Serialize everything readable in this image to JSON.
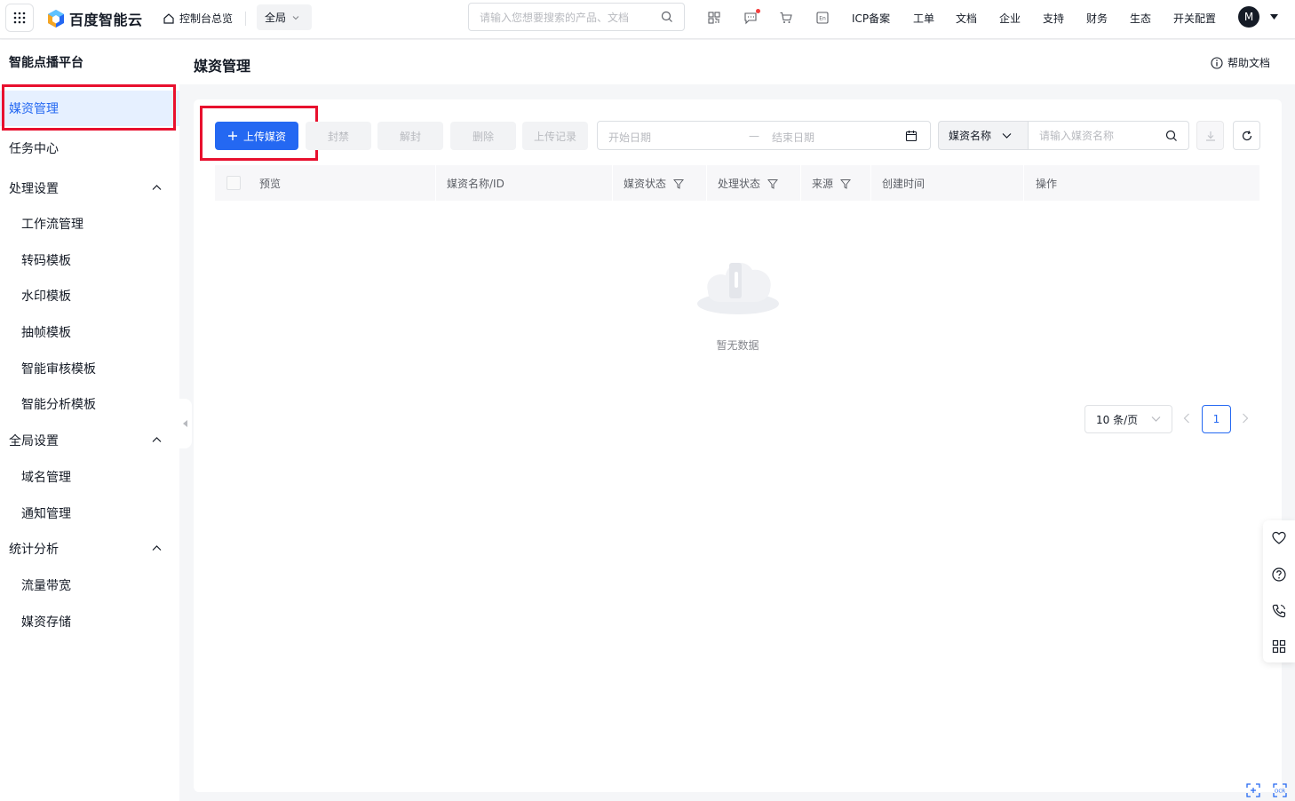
{
  "topbar": {
    "logo_text": "百度智能云",
    "console_label": "控制台总览",
    "region_label": "全局",
    "search_placeholder": "请输入您想要搜索的产品、文档",
    "nav": [
      "ICP备案",
      "工单",
      "文档",
      "企业",
      "支持",
      "财务",
      "生态",
      "开关配置"
    ],
    "avatar_letter": "M"
  },
  "sidebar": {
    "title": "智能点播平台",
    "items": [
      {
        "label": "媒资管理",
        "level": "top",
        "active": true
      },
      {
        "label": "任务中心",
        "level": "top"
      },
      {
        "label": "处理设置",
        "level": "group"
      },
      {
        "label": "工作流管理",
        "level": "sub"
      },
      {
        "label": "转码模板",
        "level": "sub"
      },
      {
        "label": "水印模板",
        "level": "sub"
      },
      {
        "label": "抽帧模板",
        "level": "sub"
      },
      {
        "label": "智能审核模板",
        "level": "sub"
      },
      {
        "label": "智能分析模板",
        "level": "sub"
      },
      {
        "label": "全局设置",
        "level": "group"
      },
      {
        "label": "域名管理",
        "level": "sub"
      },
      {
        "label": "通知管理",
        "level": "sub"
      },
      {
        "label": "统计分析",
        "level": "group"
      },
      {
        "label": "流量带宽",
        "level": "sub"
      },
      {
        "label": "媒资存储",
        "level": "sub"
      }
    ]
  },
  "main": {
    "page_title": "媒资管理",
    "help_doc": "帮助文档",
    "toolbar": {
      "upload_label": "上传媒资",
      "ban_label": "封禁",
      "unban_label": "解封",
      "delete_label": "删除",
      "upload_record_label": "上传记录",
      "start_date_placeholder": "开始日期",
      "end_date_placeholder": "结束日期",
      "date_separator": "—",
      "filter_field": "媒资名称",
      "name_search_placeholder": "请输入媒资名称"
    },
    "table": {
      "columns": [
        "预览",
        "媒资名称/ID",
        "媒资状态",
        "处理状态",
        "来源",
        "创建时间",
        "操作"
      ],
      "rows": [],
      "empty_text": "暂无数据"
    },
    "pagination": {
      "page_size": "10 条/页",
      "current_page": "1"
    }
  },
  "colors": {
    "primary": "#2468f2",
    "highlight": "#e8102e"
  }
}
